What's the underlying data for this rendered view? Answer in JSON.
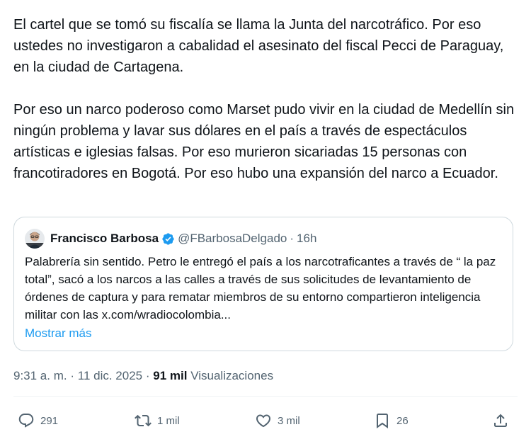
{
  "tweet": {
    "paragraphs": [
      "El cartel que se tomó su fiscalía se llama la Junta del narcotráfico. Por eso ustedes no investigaron a cabalidad el asesinato del fiscal Pecci de Paraguay, en la ciudad de Cartagena.",
      "Por eso un narco poderoso como Marset pudo vivir en la ciudad de Medellín sin ningún problema y lavar sus dólares en el país a través de espectáculos artísticas e iglesias falsas. Por eso murieron sicariadas 15 personas con francotiradores en Bogotá. Por eso hubo una expansión del narco a Ecuador."
    ]
  },
  "quote": {
    "name": "Francisco Barbosa",
    "handle": "@FBarbosaDelgado",
    "dot": "·",
    "time": "16h",
    "text": "Palabrería sin sentido. Petro le entregó el país a los narcotraficantes a través de “ la paz total”, sacó a los narcos a las calles a través de sus solicitudes de levantamiento de órdenes de captura y para rematar miembros de su entorno compartieron inteligencia militar con las x.com/wradiocolombia...",
    "show_more": "Mostrar más",
    "verified_color": "#1d9bf0",
    "avatar_icon": "user-avatar"
  },
  "meta": {
    "time": "9:31 a. m.",
    "sep1": "·",
    "date": "11 dic. 2025",
    "sep2": "·",
    "views_count": "91 mil",
    "views_label": "Visualizaciones"
  },
  "actions": {
    "replies": "291",
    "reposts": "1 mil",
    "likes": "3 mil",
    "bookmarks": "26"
  },
  "colors": {
    "text": "#0f1419",
    "secondary": "#536471",
    "link": "#1d9bf0",
    "border": "#cfd9de"
  }
}
